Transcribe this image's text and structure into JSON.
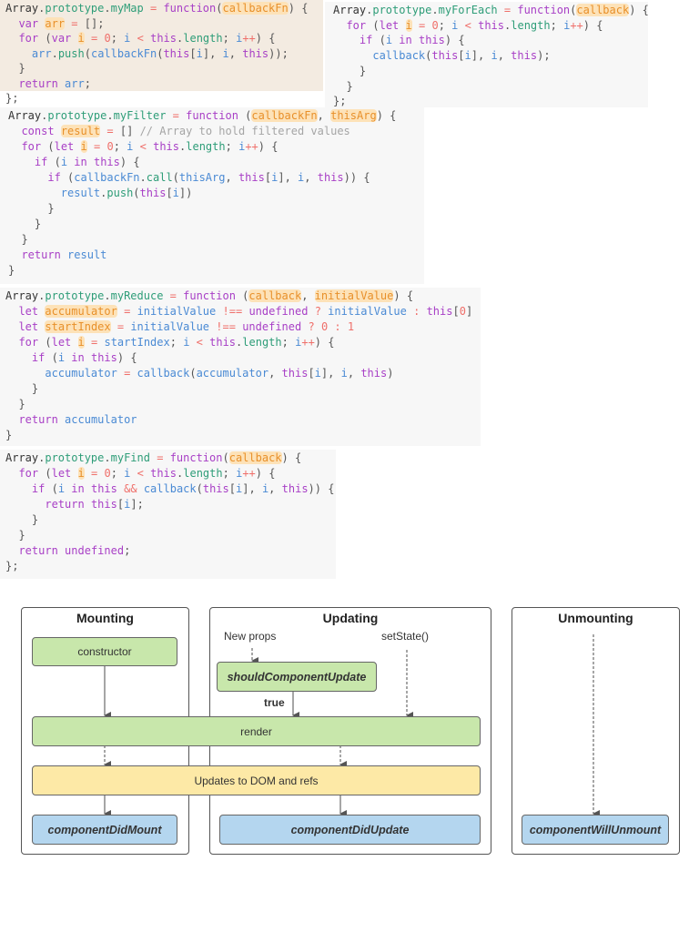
{
  "code_blocks": [
    {
      "name": "myMap",
      "bg": "#f3ebe1",
      "hl": [
        [
          0,
          "callbackFn"
        ],
        [
          1,
          "arr"
        ],
        [
          2,
          "i"
        ]
      ],
      "lines": [
        "Array.prototype.myMap = function(callbackFn) {",
        "  var arr = [];",
        "  for (var i = 0; i < this.length; i++) {",
        "    arr.push(callbackFn(this[i], i, this));",
        "  }",
        "  return arr;",
        "};"
      ]
    },
    {
      "name": "myForEach",
      "bg": "#f7f7f7",
      "hl": [
        [
          0,
          "callback"
        ],
        [
          1,
          "i"
        ]
      ],
      "lines": [
        "Array.prototype.myForEach = function(callback) {",
        "  for (let i = 0; i < this.length; i++) {",
        "    if (i in this) {",
        "      callback(this[i], i, this);",
        "    }",
        "  }",
        "};"
      ]
    },
    {
      "name": "myFilter",
      "bg": "#f7f7f7",
      "hl": [
        [
          0,
          "callbackFn"
        ],
        [
          0,
          "thisArg"
        ],
        [
          1,
          "result"
        ],
        [
          2,
          "i"
        ]
      ],
      "lines": [
        "Array.prototype.myFilter = function (callbackFn, thisArg) {",
        "  const result = [] // Array to hold filtered values",
        "  for (let i = 0; i < this.length; i++) {",
        "    if (i in this) {",
        "      if (callbackFn.call(thisArg, this[i], i, this)) {",
        "        result.push(this[i])",
        "      }",
        "    }",
        "  }",
        "  return result",
        "}"
      ]
    },
    {
      "name": "myReduce",
      "bg": "#f7f7f7",
      "hl": [
        [
          0,
          "callback"
        ],
        [
          0,
          "initialValue"
        ],
        [
          1,
          "accumulator"
        ],
        [
          2,
          "startIndex"
        ],
        [
          3,
          "i"
        ]
      ],
      "lines": [
        "Array.prototype.myReduce = function (callback, initialValue) {",
        "  let accumulator = initialValue !== undefined ? initialValue : this[0]",
        "  let startIndex = initialValue !== undefined ? 0 : 1",
        "  for (let i = startIndex; i < this.length; i++) {",
        "    if (i in this) {",
        "      accumulator = callback(accumulator, this[i], i, this)",
        "    }",
        "  }",
        "  return accumulator",
        "}"
      ]
    },
    {
      "name": "myFind",
      "bg": "#f7f7f7",
      "hl": [
        [
          0,
          "callback"
        ],
        [
          1,
          "i"
        ]
      ],
      "lines": [
        "Array.prototype.myFind = function(callback) {",
        "  for (let i = 0; i < this.length; i++) {",
        "    if (i in this && callback(this[i], i, this)) {",
        "      return this[i];",
        "    }",
        "  }",
        "  return undefined;",
        "};"
      ]
    }
  ],
  "diagram": {
    "panels": {
      "mounting": "Mounting",
      "updating": "Updating",
      "unmounting": "Unmounting"
    },
    "labels": {
      "new_props": "New props",
      "set_state": "setState()",
      "true": "true"
    },
    "boxes": {
      "constructor": "constructor",
      "should_update": "shouldComponentUpdate",
      "render": "render",
      "updates_dom": "Updates to DOM and refs",
      "did_mount": "componentDidMount",
      "did_update": "componentDidUpdate",
      "will_unmount": "componentWillUnmount"
    },
    "colors": {
      "green": "#c8e7ab",
      "yellow": "#fde9a6",
      "blue": "#b4d6ef"
    }
  }
}
